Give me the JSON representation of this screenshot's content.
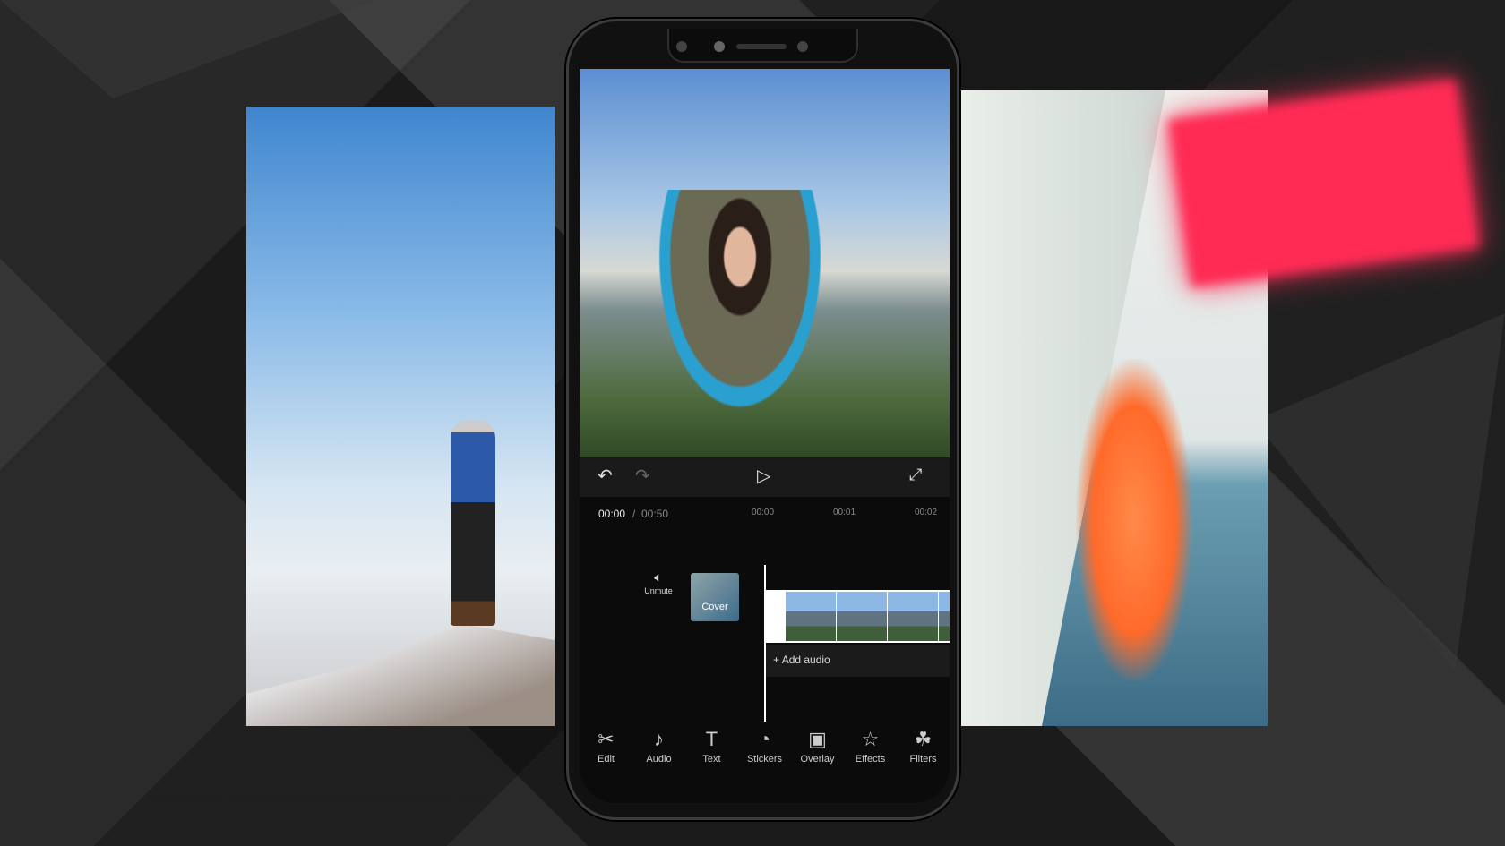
{
  "player": {
    "current_time": "00:00",
    "separator": "/",
    "total_time": "00:50",
    "ticks": [
      "00:00",
      "00:01",
      "00:02"
    ]
  },
  "timeline": {
    "unmute_label": "Unmute",
    "cover_label": "Cover",
    "add_audio_label": "Add audio"
  },
  "toolbar": {
    "items": [
      {
        "label": "Edit",
        "icon": "scissors-icon",
        "glyph": "✂"
      },
      {
        "label": "Audio",
        "icon": "music-note-icon",
        "glyph": "♪"
      },
      {
        "label": "Text",
        "icon": "text-icon",
        "glyph": "T"
      },
      {
        "label": "Stickers",
        "icon": "sticker-icon",
        "glyph": "◔"
      },
      {
        "label": "Overlay",
        "icon": "overlay-icon",
        "glyph": "▣"
      },
      {
        "label": "Effects",
        "icon": "star-icon",
        "glyph": "☆"
      },
      {
        "label": "Filters",
        "icon": "filter-icon",
        "glyph": "☘"
      }
    ]
  },
  "colors": {
    "accent": "#ff2b55",
    "screen_bg": "#0b0b0b"
  }
}
